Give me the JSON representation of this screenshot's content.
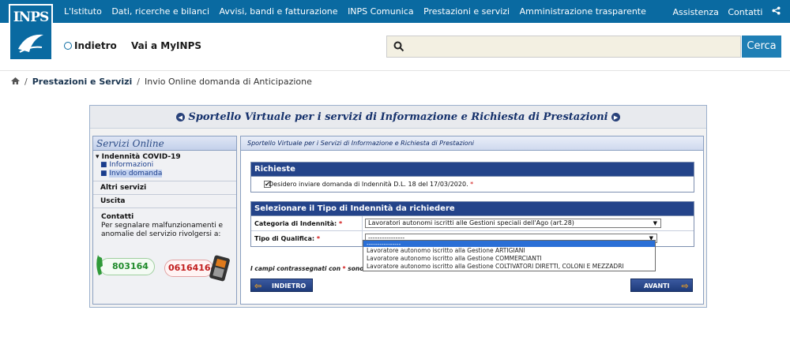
{
  "header": {
    "logo_text": "INPS",
    "nav": [
      "L'Istituto",
      "Dati, ricerche e bilanci",
      "Avvisi, bandi e fatturazione",
      "INPS Comunica",
      "Prestazioni e servizi",
      "Amministrazione trasparente"
    ],
    "right_links": [
      "Assistenza",
      "Contatti"
    ],
    "share_icon": "share-icon"
  },
  "subbar": {
    "back_label": "Indietro",
    "myinps_label": "Vai a MyINPS",
    "search_placeholder": "",
    "search_button": "Cerca"
  },
  "breadcrumb": {
    "home_icon": "home-icon",
    "items": [
      "Prestazioni e Servizi",
      "Invio Online domanda di Anticipazione"
    ]
  },
  "panel": {
    "title": "Sportello Virtuale per i servizi di Informazione e Richiesta di Prestazioni",
    "sidebar": {
      "heading": "Servizi Online",
      "section_covid": "Indennità COVID-19",
      "sub_items": [
        "Informazioni",
        "Invio domanda"
      ],
      "altri_servizi": "Altri servizi",
      "uscita": "Uscita",
      "contatti_title": "Contatti",
      "contatti_text": "Per segnalare malfunzionamenti e anomalie del servizio rivolgersi a:",
      "phone_green": "803164",
      "phone_red": "06164164"
    },
    "main": {
      "header": "Sportello Virtuale per i Servizi di Informazione e Richiesta di Prestazioni",
      "richieste": {
        "heading": "Richieste",
        "checkbox_label": "Desidero inviare domanda di Indennità D.L. 18 del 17/03/2020.",
        "checked": true
      },
      "tipo": {
        "heading": "Selezionare il Tipo di Indennità da richiedere",
        "categoria_label": "Categoria di Indennità:",
        "categoria_value": "Lavoratori autonomi iscritti alle Gestioni speciali dell'Ago (art.28)",
        "qualifica_label": "Tipo di Qualifica:",
        "qualifica_value": "----------------",
        "options": [
          "----------------",
          "Lavoratore autonomo iscritto alla Gestione ARTIGIANI",
          "Lavoratore autonomo iscritto alla Gestione COMMERCIANTI",
          "Lavoratore autonomo iscritto alla Gestione COLTIVATORI DIRETTI, COLONI E MEZZADRI"
        ]
      },
      "note": "I campi contrassegnati con",
      "note_tail": "sono",
      "back_button": "INDIETRO",
      "next_button": "AVANTI"
    }
  }
}
